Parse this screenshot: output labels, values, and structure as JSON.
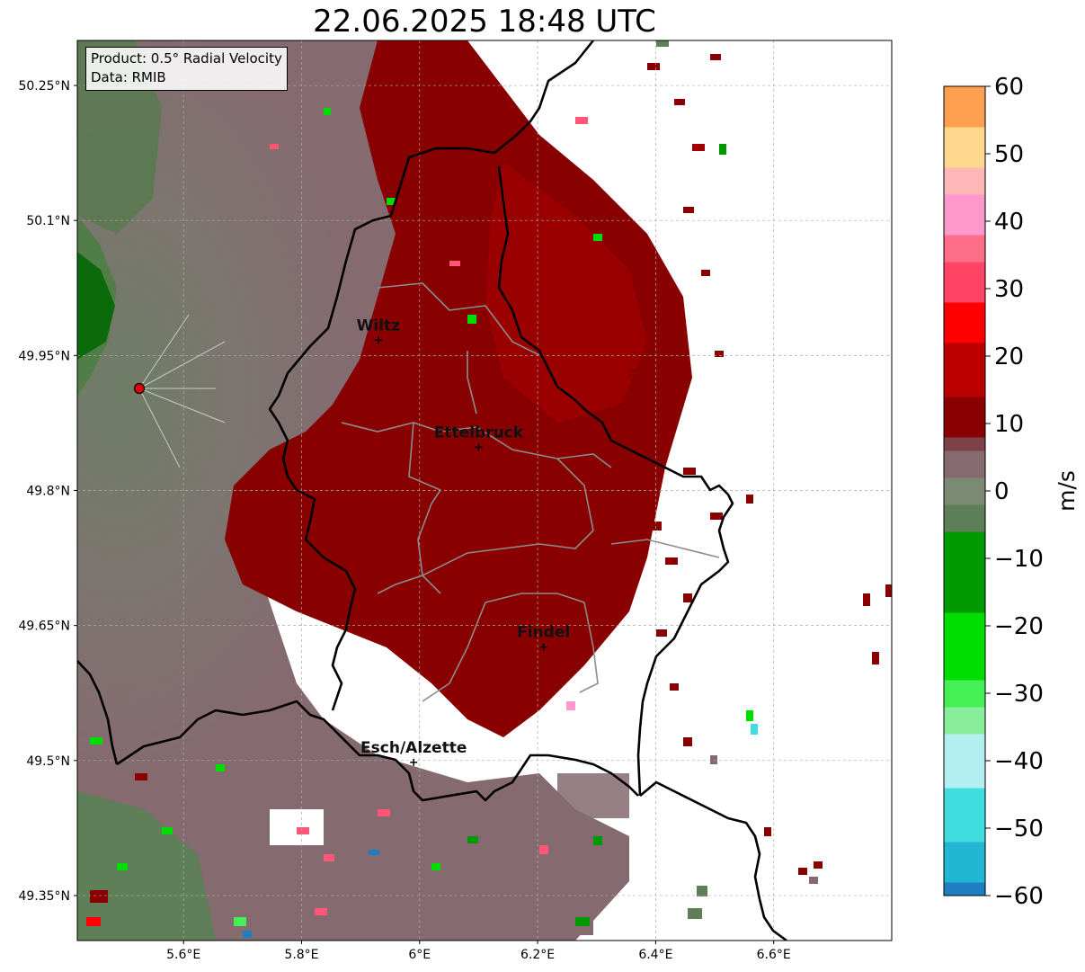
{
  "title": "22.06.2025 18:48 UTC",
  "info": {
    "product": "Product: 0.5° Radial Velocity",
    "data": "Data: RMIB"
  },
  "map": {
    "lon_range": [
      5.42,
      6.8
    ],
    "lat_range": [
      49.3,
      50.3
    ],
    "lon_ticks": [
      {
        "value": 5.6,
        "label": "5.6°E"
      },
      {
        "value": 5.8,
        "label": "5.8°E"
      },
      {
        "value": 6.0,
        "label": "6°E"
      },
      {
        "value": 6.2,
        "label": "6.2°E"
      },
      {
        "value": 6.4,
        "label": "6.4°E"
      },
      {
        "value": 6.6,
        "label": "6.6°E"
      }
    ],
    "lat_ticks": [
      {
        "value": 49.35,
        "label": "49.35°N"
      },
      {
        "value": 49.5,
        "label": "49.5°N"
      },
      {
        "value": 49.65,
        "label": "49.65°N"
      },
      {
        "value": 49.8,
        "label": "49.8°N"
      },
      {
        "value": 49.95,
        "label": "49.95°N"
      },
      {
        "value": 50.1,
        "label": "50.1°N"
      },
      {
        "value": 50.25,
        "label": "50.25°N"
      }
    ],
    "radar_site": {
      "lon": 5.525,
      "lat": 49.915
    },
    "cities": [
      {
        "name": "Wiltz",
        "lon": 5.93,
        "lat": 49.967
      },
      {
        "name": "Ettelbruck",
        "lon": 6.1,
        "lat": 49.848
      },
      {
        "name": "Findel",
        "lon": 6.21,
        "lat": 49.626
      },
      {
        "name": "Esch/Alzette",
        "lon": 5.99,
        "lat": 49.498
      }
    ]
  },
  "colorbar": {
    "label": "m/s",
    "range": [
      -60,
      60
    ],
    "ticks": [
      {
        "value": 60,
        "label": "60"
      },
      {
        "value": 50,
        "label": "50"
      },
      {
        "value": 40,
        "label": "40"
      },
      {
        "value": 30,
        "label": "30"
      },
      {
        "value": 20,
        "label": "20"
      },
      {
        "value": 10,
        "label": "10"
      },
      {
        "value": 0,
        "label": "0"
      },
      {
        "value": -10,
        "label": "−10"
      },
      {
        "value": -20,
        "label": "−20"
      },
      {
        "value": -30,
        "label": "−30"
      },
      {
        "value": -40,
        "label": "−40"
      },
      {
        "value": -50,
        "label": "−50"
      },
      {
        "value": -60,
        "label": "−60"
      }
    ],
    "segments": [
      {
        "from": -60,
        "to": -58,
        "color": "#1f7fc2"
      },
      {
        "from": -58,
        "to": -52,
        "color": "#22b6d2"
      },
      {
        "from": -52,
        "to": -44,
        "color": "#3fdde0"
      },
      {
        "from": -44,
        "to": -36,
        "color": "#b3eef0"
      },
      {
        "from": -36,
        "to": -32,
        "color": "#88ee99"
      },
      {
        "from": -32,
        "to": -28,
        "color": "#44f055"
      },
      {
        "from": -28,
        "to": -18,
        "color": "#00dd00"
      },
      {
        "from": -18,
        "to": -6,
        "color": "#009900"
      },
      {
        "from": -6,
        "to": -2,
        "color": "#5e7f58"
      },
      {
        "from": -2,
        "to": 2,
        "color": "#7c8a74"
      },
      {
        "from": 2,
        "to": 6,
        "color": "#856a70"
      },
      {
        "from": 6,
        "to": 8,
        "color": "#7c4248"
      },
      {
        "from": 8,
        "to": 14,
        "color": "#8a0000"
      },
      {
        "from": 14,
        "to": 22,
        "color": "#bb0000"
      },
      {
        "from": 22,
        "to": 28,
        "color": "#ff0000"
      },
      {
        "from": 28,
        "to": 34,
        "color": "#ff4466"
      },
      {
        "from": 34,
        "to": 38,
        "color": "#ff6e88"
      },
      {
        "from": 38,
        "to": 44,
        "color": "#ff99cc"
      },
      {
        "from": 44,
        "to": 48,
        "color": "#ffb8b8"
      },
      {
        "from": 48,
        "to": 54,
        "color": "#ffd88e"
      },
      {
        "from": 54,
        "to": 60,
        "color": "#ffa050"
      }
    ]
  }
}
